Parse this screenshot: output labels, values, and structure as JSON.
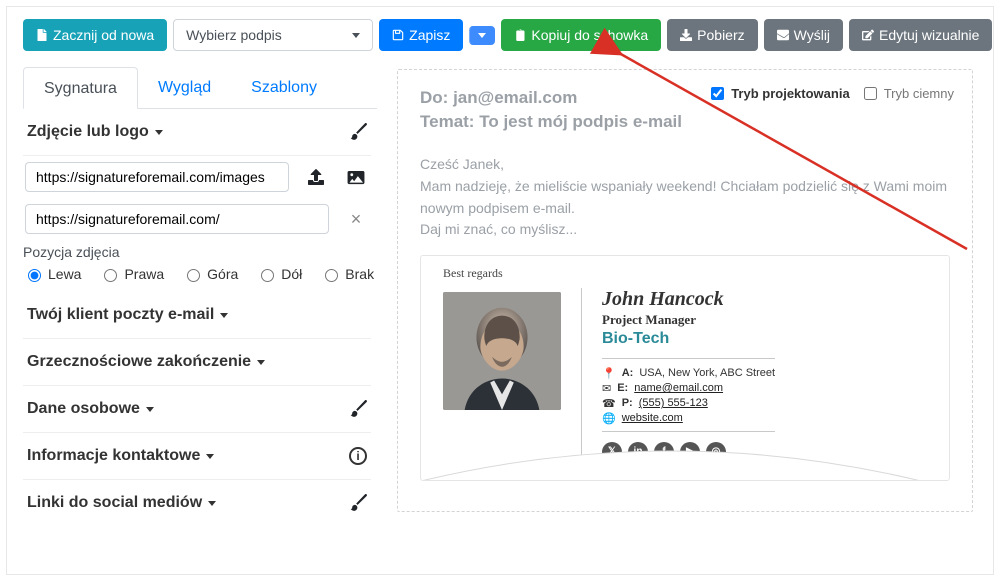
{
  "topbar": {
    "start_over": "Zacznij od nowa",
    "select_placeholder": "Wybierz podpis",
    "save": "Zapisz",
    "copy": "Kopiuj do schowka",
    "download": "Pobierz",
    "send": "Wyślij",
    "edit": "Edytuj wizualnie"
  },
  "tabs": {
    "sig": "Sygnatura",
    "look": "Wygląd",
    "templates": "Szablony"
  },
  "sections": {
    "photo": "Zdjęcie lub logo",
    "img_url": "https://signatureforemail.com/images",
    "link_url": "https://signatureforemail.com/",
    "position_label": "Pozycja zdjęcia",
    "pos": {
      "left": "Lewa",
      "right": "Prawa",
      "top": "Góra",
      "bottom": "Dół",
      "none": "Brak"
    },
    "client": "Twój klient poczty e-mail",
    "greeting": "Grzecznościowe zakończenie",
    "personal": "Dane osobowe",
    "contact": "Informacje kontaktowe",
    "social": "Linki do social mediów"
  },
  "preview": {
    "to_label": "Do:",
    "to_value": "jan@email.com",
    "subject_label": "Temat:",
    "subject_value": "To jest mój podpis e-mail",
    "design_mode": "Tryb projektowania",
    "dark_mode": "Tryb ciemny",
    "body1": "Cześć Janek,",
    "body2": "Mam nadzieję, że mieliście wspaniały weekend! Chciałam podzielić się z Wami moim nowym podpisem e-mail.",
    "body3": "Daj mi znać, co myślisz..."
  },
  "signature": {
    "regards": "Best regards",
    "name": "John Hancock",
    "title": "Project Manager",
    "company": "Bio-Tech",
    "address_label": "A:",
    "address": "USA, New York, ABC Street",
    "email_label": "E:",
    "email": "name@email.com",
    "phone_label": "P:",
    "phone": "(555) 555-123",
    "website": "website.com"
  }
}
